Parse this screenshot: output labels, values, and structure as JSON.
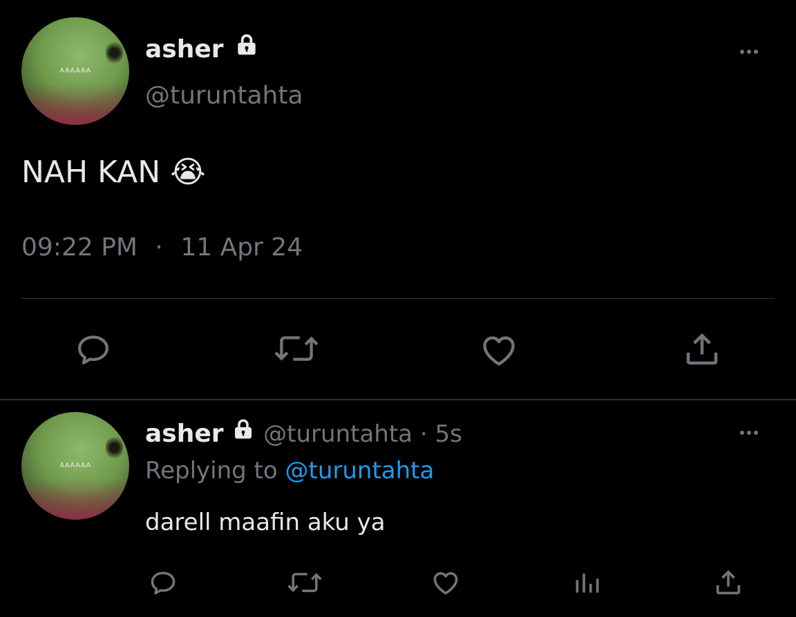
{
  "main_tweet": {
    "avatar_text": "AAAAAA",
    "display_name": "asher",
    "handle": "@turuntahta",
    "text": "NAH KAN",
    "emoji": "😭",
    "time": "09:22 PM",
    "separator": "·",
    "date": "11 Apr 24",
    "actions": [
      "reply-icon",
      "retweet-icon",
      "like-icon",
      "share-icon"
    ]
  },
  "reply_tweet": {
    "avatar_text": "AAAAAA",
    "display_name": "asher",
    "handle": "@turuntahta",
    "dot": "·",
    "age": "5s",
    "replying_prefix": "Replying to",
    "replying_handle": "@turuntahta",
    "text": "darell maafin aku ya",
    "actions": [
      "reply-icon",
      "retweet-icon",
      "like-icon",
      "analytics-icon",
      "share-icon"
    ]
  },
  "colors": {
    "background": "#000000",
    "text": "#e7e9ea",
    "muted": "#71767b",
    "link": "#1d9bf0",
    "divider": "#2f3336"
  }
}
